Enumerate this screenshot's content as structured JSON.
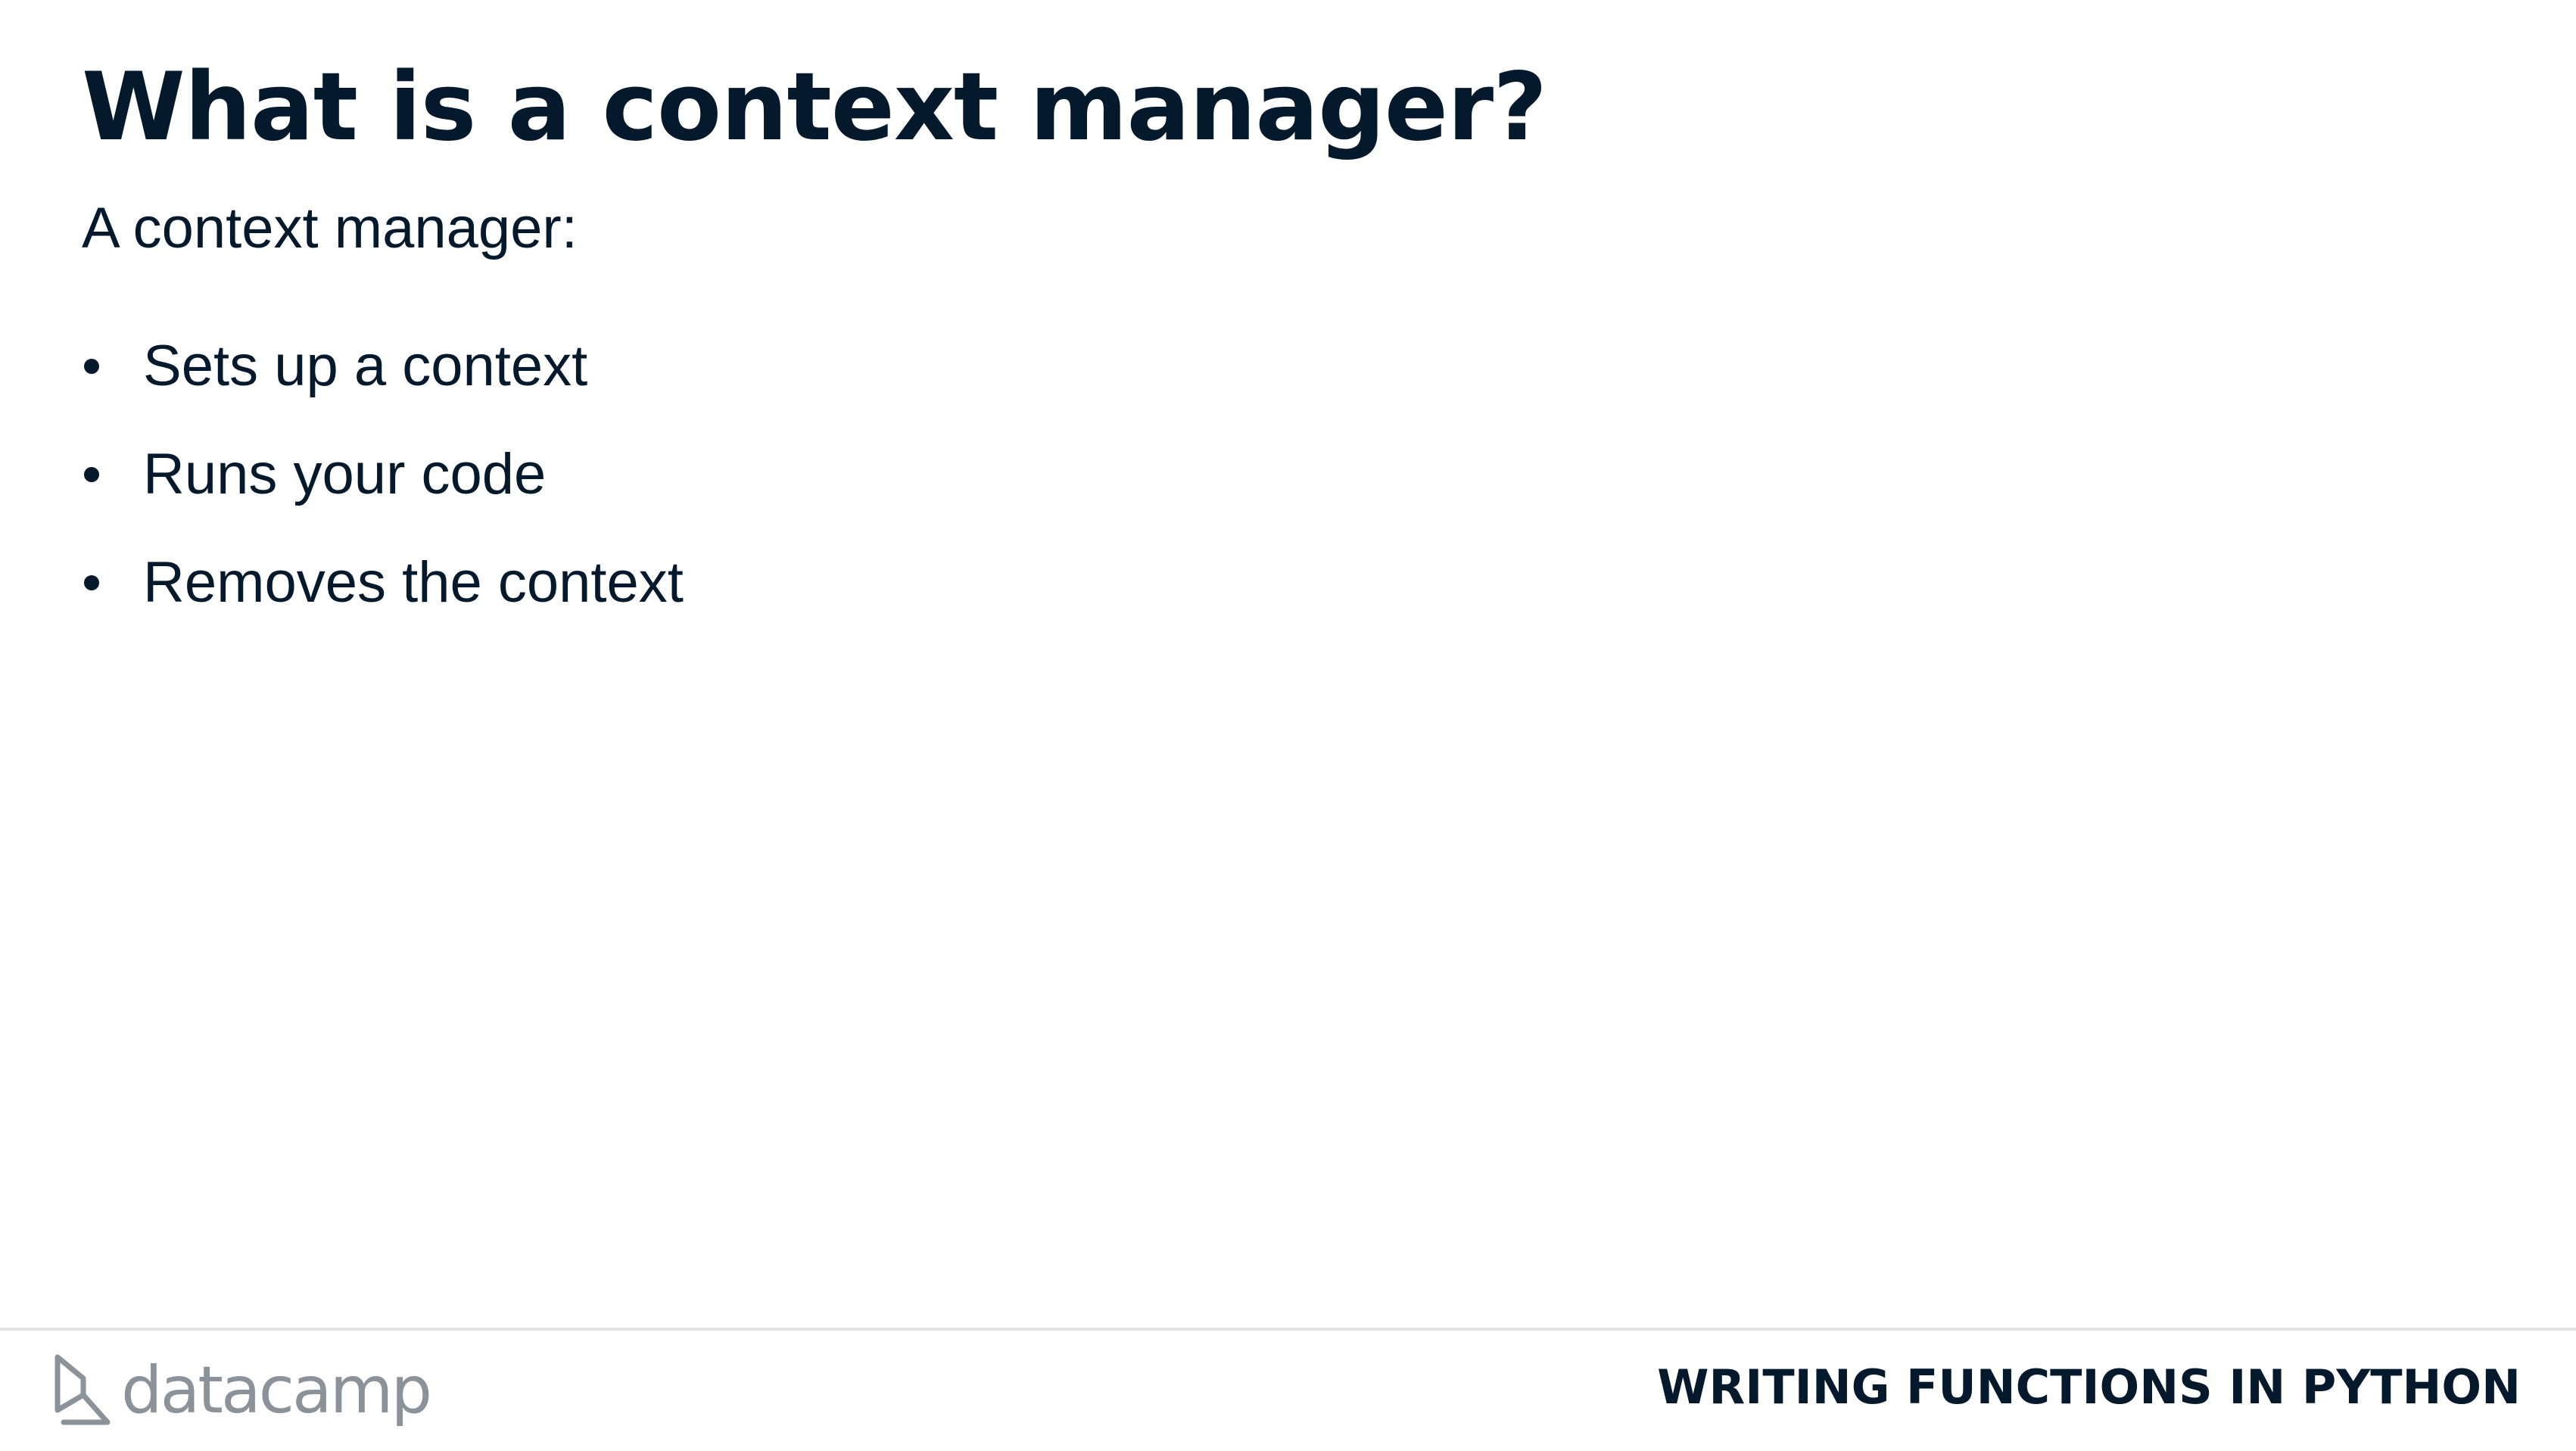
{
  "slide": {
    "title": "What is a context manager?",
    "intro": "A context manager:",
    "bullets": [
      "Sets up a context",
      "Runs your code",
      "Removes the context"
    ]
  },
  "footer": {
    "logo_text": "datacamp",
    "course_title": "WRITING FUNCTIONS IN PYTHON"
  },
  "colors": {
    "text": "#05192d",
    "logo": "#8c929a",
    "rule": "#e3e3e3",
    "background": "#ffffff"
  },
  "icons": {
    "logo_mark": "datacamp-logo-icon",
    "bullet": "bullet-dot"
  }
}
